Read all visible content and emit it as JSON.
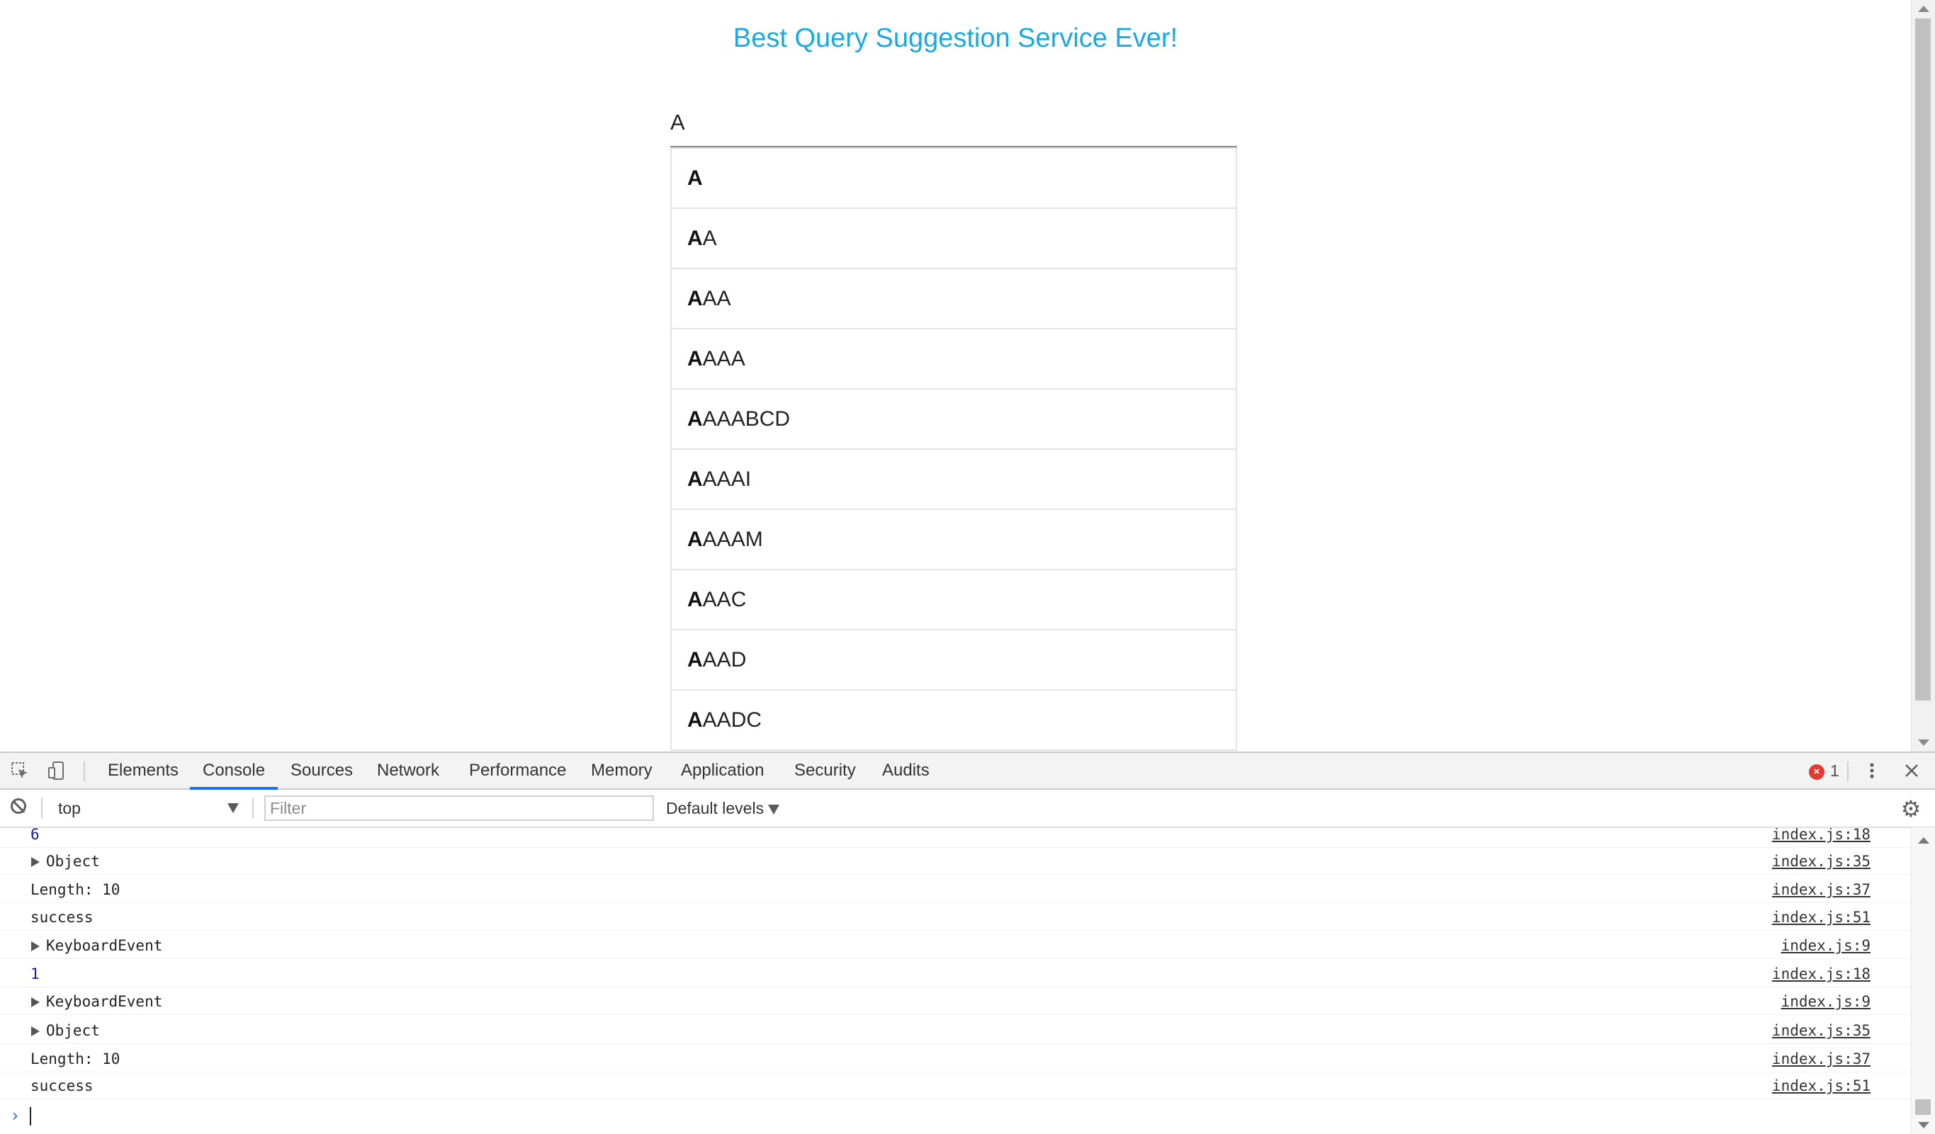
{
  "page": {
    "title": "Best Query Suggestion Service Ever!",
    "query": "A",
    "suggestions": [
      {
        "match": "A",
        "rest": ""
      },
      {
        "match": "A",
        "rest": "A"
      },
      {
        "match": "A",
        "rest": "AA"
      },
      {
        "match": "A",
        "rest": "AAA"
      },
      {
        "match": "A",
        "rest": "AAABCD"
      },
      {
        "match": "A",
        "rest": "AAAI"
      },
      {
        "match": "A",
        "rest": "AAAM"
      },
      {
        "match": "A",
        "rest": "AAC"
      },
      {
        "match": "A",
        "rest": "AAD"
      },
      {
        "match": "A",
        "rest": "AADC"
      }
    ]
  },
  "devtools": {
    "tabs": [
      {
        "label": "Elements"
      },
      {
        "label": "Console",
        "active": true
      },
      {
        "label": "Sources"
      },
      {
        "label": "Network"
      },
      {
        "label": "Performance"
      },
      {
        "label": "Memory"
      },
      {
        "label": "Application"
      },
      {
        "label": "Security"
      },
      {
        "label": "Audits"
      }
    ],
    "error_count": "1",
    "context": "top",
    "filter_placeholder": "Filter",
    "levels_label": "Default levels",
    "logs": [
      {
        "text": "6",
        "kind": "number",
        "expandable": false,
        "source": "index.js:18"
      },
      {
        "text": "Object",
        "kind": "object",
        "expandable": true,
        "source": "index.js:35"
      },
      {
        "text": "Length: 10",
        "kind": "text",
        "expandable": false,
        "source": "index.js:37"
      },
      {
        "text": "success",
        "kind": "text",
        "expandable": false,
        "source": "index.js:51"
      },
      {
        "text": "KeyboardEvent",
        "kind": "object",
        "expandable": true,
        "source": "index.js:9"
      },
      {
        "text": "1",
        "kind": "number",
        "expandable": false,
        "source": "index.js:18"
      },
      {
        "text": "KeyboardEvent",
        "kind": "object",
        "expandable": true,
        "source": "index.js:9"
      },
      {
        "text": "Object",
        "kind": "object",
        "expandable": true,
        "source": "index.js:35"
      },
      {
        "text": "Length: 10",
        "kind": "text",
        "expandable": false,
        "source": "index.js:37"
      },
      {
        "text": "success",
        "kind": "text",
        "expandable": false,
        "source": "index.js:51"
      }
    ],
    "colors": {
      "accent": "#1a73e8",
      "title": "#1aa9e0",
      "error": "#e53935"
    }
  }
}
